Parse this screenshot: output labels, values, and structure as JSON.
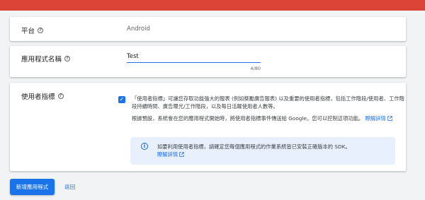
{
  "colors": {
    "topbar": "#db4437",
    "accent": "#1a73e8",
    "info_bg": "#e8f0fe"
  },
  "platform": {
    "label": "平台",
    "value": "Android",
    "icon": "help-icon"
  },
  "app_name": {
    "label": "應用程式名稱",
    "value": "Test",
    "counter": "4/80",
    "icon": "help-icon"
  },
  "user_metrics": {
    "label": "使用者指標",
    "icon": "help-icon",
    "checked": true,
    "description": "「使用者指標」可讓您存取功能強大的報表 (例如獎勵廣告報表) 以及重要的使用者指標，包括工作階段/使用者、工作階段持續時間、廣告曝光/工作階段，以及每日活躍使用者人數等。",
    "default_note": "根據預設，系統會在您的應用程式開始時，將使用者指標事件傳送給 Google。您可以控制這項功能。",
    "learn_more": "瞭解詳情",
    "info": {
      "text": "如要利用使用者指標，請確定您每個應用程式的作業系統皆已安裝正確版本的 SDK。",
      "learn_more": "瞭解詳情"
    }
  },
  "actions": {
    "add_app": "新增應用程式",
    "back": "返回"
  }
}
